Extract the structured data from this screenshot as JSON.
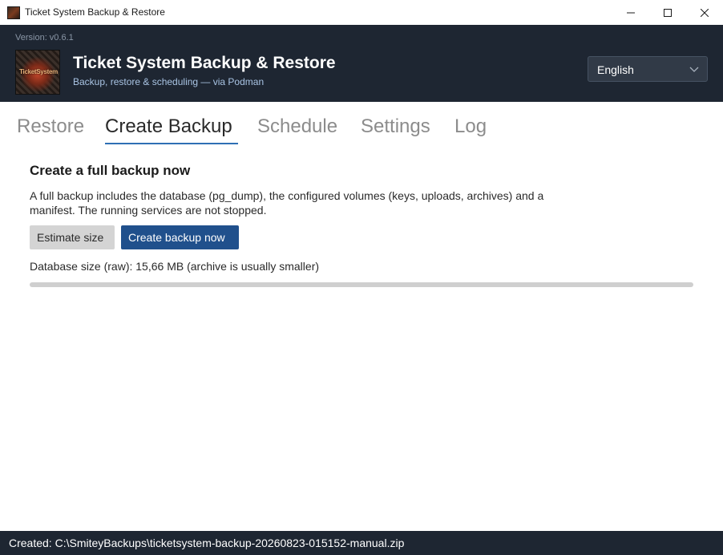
{
  "window": {
    "title": "Ticket System Backup & Restore"
  },
  "header": {
    "version": "Version: v0.6.1",
    "logo_text": "TicketSystem",
    "title": "Ticket System Backup & Restore",
    "subtitle": "Backup, restore & scheduling — via Podman",
    "language": {
      "selected": "English"
    }
  },
  "tabs": [
    {
      "label": "Restore",
      "active": false
    },
    {
      "label": "Create Backup",
      "active": true
    },
    {
      "label": "Schedule",
      "active": false
    },
    {
      "label": "Settings",
      "active": false
    },
    {
      "label": "Log",
      "active": false
    }
  ],
  "backup": {
    "heading": "Create a full backup now",
    "description": "A full backup includes the database (pg_dump), the configured volumes (keys, uploads, archives) and a manifest. The running services are not stopped.",
    "estimate_button": "Estimate size",
    "create_button": "Create backup now",
    "db_size_text": "Database size (raw): 15,66 MB (archive is usually smaller)",
    "progress": 0
  },
  "status": {
    "text": "Created: C:\\SmiteyBackups\\ticketsystem-backup-20260823-015152-manual.zip"
  },
  "colors": {
    "header_bg": "#1e2632",
    "accent": "#20508c",
    "tab_underline": "#2f6fb4",
    "subtitle": "#a9c4e4"
  },
  "icons": {
    "app": "app-icon",
    "minimize": "minimize-icon",
    "maximize": "maximize-icon",
    "close": "close-icon",
    "dropdown": "chevron-down-icon"
  }
}
